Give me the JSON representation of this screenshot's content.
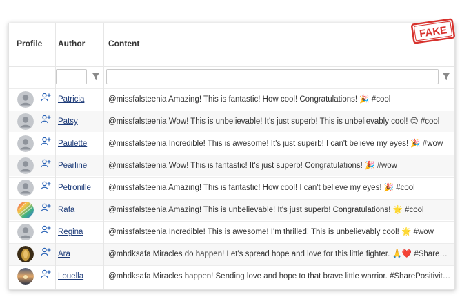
{
  "headers": {
    "profile": "Profile",
    "author": "Author",
    "content": "Content"
  },
  "stamp": "FAKE",
  "colors": {
    "link": "#1f3d7a",
    "stamp": "#d7322d",
    "icon_blue": "#2a63b6"
  },
  "rows": [
    {
      "author": "Patricia",
      "avatar": "default",
      "content": "@missfalsteenia Amazing! This is fantastic! How cool! Congratulations! 🎉 #cool"
    },
    {
      "author": "Patsy",
      "avatar": "default",
      "content": "@missfalsteenia Wow! This is unbelievable! It's just superb! This is unbelievably cool! 😊 #cool"
    },
    {
      "author": "Paulette",
      "avatar": "default",
      "content": "@missfalsteenia Incredible! This is awesome! It's just superb! I can't believe my eyes! 🎉 #wow"
    },
    {
      "author": "Pearline",
      "avatar": "default",
      "content": "@missfalsteenia Wow! This is fantastic! It's just superb! Congratulations! 🎉 #wow"
    },
    {
      "author": "Petronille",
      "avatar": "default",
      "content": "@missfalsteenia Amazing! This is fantastic! How cool! I can't believe my eyes! 🎉 #cool"
    },
    {
      "author": "Rafa",
      "avatar": "colorful",
      "content": "@missfalsteenia Amazing! This is unbelievable! It's just superb! Congratulations! 🌟 #cool"
    },
    {
      "author": "Regina",
      "avatar": "default",
      "content": "@missfalsteenia Incredible! This is awesome! I'm thrilled! This is unbelievably cool! 🌟 #wow"
    },
    {
      "author": "Ara",
      "avatar": "photo-gold",
      "content": "@mhdksafa Miracles do happen! Let's spread hope and love for this little fighter. 🙏❤️ #SharePositivity"
    },
    {
      "author": "Louella",
      "avatar": "photo-sunset",
      "content": "@mhdksafa Miracles happen! Sending love and hope to that brave little warrior. #SharePositivity 💗"
    }
  ]
}
